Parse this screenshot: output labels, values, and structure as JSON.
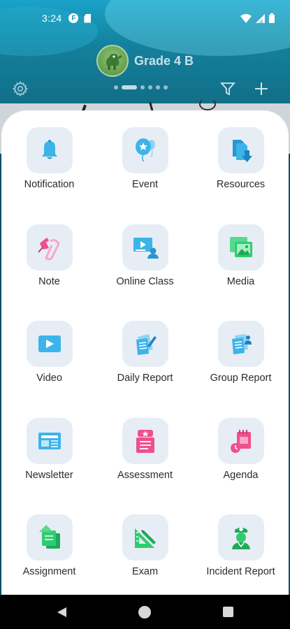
{
  "status_bar": {
    "time": "3:24",
    "notification_badge": "F",
    "icons": [
      "app-notification-icon",
      "sd-card-icon",
      "wifi-icon",
      "signal-icon",
      "battery-icon"
    ]
  },
  "header": {
    "class_name": "Grade 4 B",
    "pager": {
      "count": 6,
      "active_index": 1
    },
    "actions": [
      "settings-icon",
      "filter-icon",
      "add-icon"
    ]
  },
  "menu": {
    "items": [
      {
        "label": "Notification",
        "icon": "bell-icon"
      },
      {
        "label": "Event",
        "icon": "balloon-icon"
      },
      {
        "label": "Resources",
        "icon": "documents-download-icon"
      },
      {
        "label": "Note",
        "icon": "pin-paperclip-icon"
      },
      {
        "label": "Online Class",
        "icon": "online-class-icon"
      },
      {
        "label": "Media",
        "icon": "media-gallery-icon"
      },
      {
        "label": "Video",
        "icon": "video-play-icon"
      },
      {
        "label": "Daily Report",
        "icon": "daily-report-icon"
      },
      {
        "label": "Group Report",
        "icon": "group-report-icon"
      },
      {
        "label": "Newsletter",
        "icon": "newsletter-icon"
      },
      {
        "label": "Assessment",
        "icon": "assessment-icon"
      },
      {
        "label": "Agenda",
        "icon": "agenda-icon"
      },
      {
        "label": "Assignment",
        "icon": "assignment-icon"
      },
      {
        "label": "Exam",
        "icon": "exam-icon"
      },
      {
        "label": "Incident Report",
        "icon": "incident-report-icon"
      }
    ]
  },
  "colors": {
    "header_bg": "#14809c",
    "tile_bg": "#e7edf5",
    "blue_icon": "#3cb4ea",
    "pink_icon": "#ef4f8c",
    "green_icon": "#2ecc71"
  },
  "nav_bar": {
    "buttons": [
      "back-icon",
      "home-icon",
      "recents-icon"
    ]
  }
}
